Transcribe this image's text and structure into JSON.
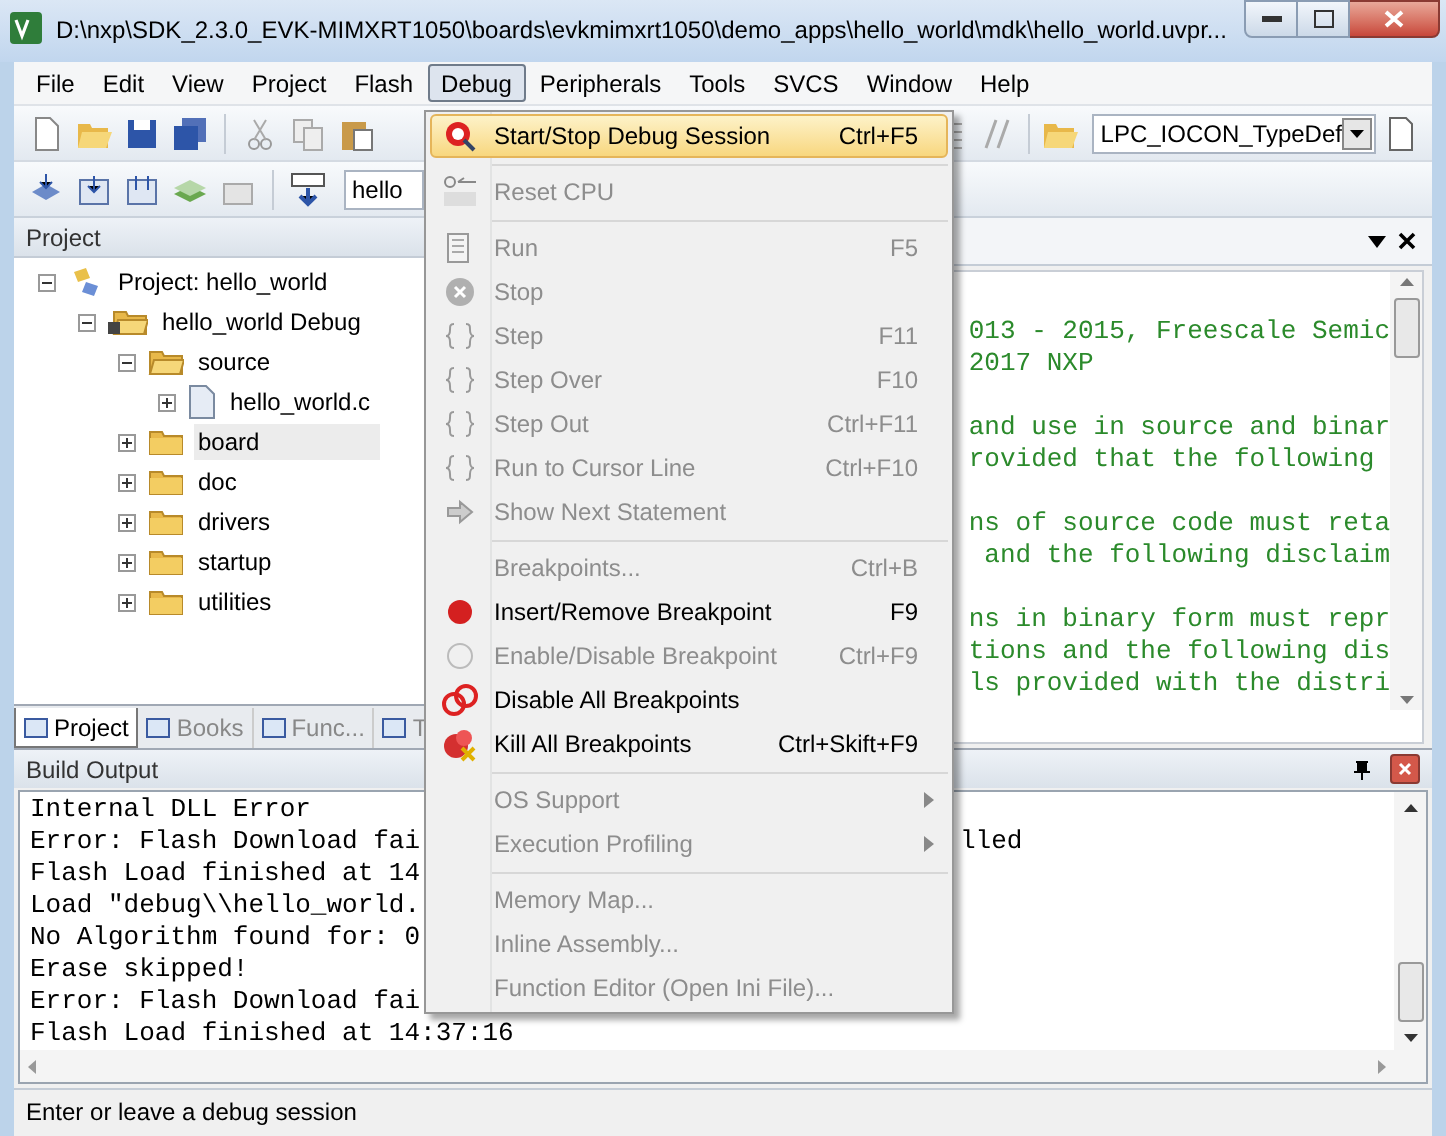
{
  "window": {
    "title": "D:\\nxp\\SDK_2.3.0_EVK-MIMXRT1050\\boards\\evkmimxrt1050\\demo_apps\\hello_world\\mdk\\hello_world.uvpr..."
  },
  "menubar": [
    {
      "label": "File",
      "selected": false
    },
    {
      "label": "Edit",
      "selected": false
    },
    {
      "label": "View",
      "selected": false
    },
    {
      "label": "Project",
      "selected": false
    },
    {
      "label": "Flash",
      "selected": false
    },
    {
      "label": "Debug",
      "selected": true
    },
    {
      "label": "Peripherals",
      "selected": false
    },
    {
      "label": "Tools",
      "selected": false
    },
    {
      "label": "SVCS",
      "selected": false
    },
    {
      "label": "Window",
      "selected": false
    },
    {
      "label": "Help",
      "selected": false
    }
  ],
  "toolbar": {
    "type_combo": "LPC_IOCON_TypeDef",
    "target_combo": "hello"
  },
  "project": {
    "title": "Project",
    "tree": [
      {
        "label": "Project: hello_world",
        "kind": "project",
        "expanded": true,
        "selected": false,
        "children": [
          {
            "label": "hello_world Debug",
            "kind": "target",
            "expanded": true,
            "selected": false,
            "children": [
              {
                "label": "source",
                "kind": "folder",
                "expanded": true,
                "selected": false,
                "children": [
                  {
                    "label": "hello_world.c",
                    "kind": "file",
                    "expanded": false,
                    "selected": false
                  }
                ]
              },
              {
                "label": "board",
                "kind": "folder",
                "expanded": false,
                "selected": true
              },
              {
                "label": "doc",
                "kind": "folder",
                "expanded": false,
                "selected": false
              },
              {
                "label": "drivers",
                "kind": "folder",
                "expanded": false,
                "selected": false
              },
              {
                "label": "startup",
                "kind": "folder",
                "expanded": false,
                "selected": false
              },
              {
                "label": "utilities",
                "kind": "folder",
                "expanded": false,
                "selected": false
              }
            ]
          }
        ]
      }
    ],
    "tabs": [
      {
        "label": "Project",
        "selected": true
      },
      {
        "label": "Books",
        "selected": false
      },
      {
        "label": "Func...",
        "selected": false
      },
      {
        "label": "T",
        "selected": false
      }
    ]
  },
  "editor": {
    "code_paragraphs": [
      [
        "013 - 2015, Freescale Semic",
        "2017 NXP"
      ],
      [
        "and use in source and binar",
        "rovided that the following"
      ],
      [
        "ns of source code must reta",
        " and the following disclaim"
      ],
      [
        "ns in binary form must repr",
        "tions and the following dis",
        "ls provided with the distri"
      ]
    ]
  },
  "build_output": {
    "title": "Build Output",
    "lines": [
      {
        "text": "Internal DLL Error"
      },
      {
        "text": "Error: Flash Download fai",
        "tail": "lled"
      },
      {
        "text": "Flash Load finished at 14"
      },
      {
        "text": "Load \"debug\\\\hello_world."
      },
      {
        "text": "No Algorithm found for: 0"
      },
      {
        "text": "Erase skipped!"
      },
      {
        "text": "Error: Flash Download fai"
      },
      {
        "text": "Flash Load finished at 14:37:16"
      }
    ]
  },
  "debug_menu": [
    {
      "kind": "item",
      "label": "Start/Stop Debug Session",
      "shortcut": "Ctrl+F5",
      "disabled": false,
      "selected": true
    },
    {
      "kind": "separator"
    },
    {
      "kind": "item",
      "label": "Reset CPU",
      "disabled": true,
      "selected": false
    },
    {
      "kind": "separator"
    },
    {
      "kind": "item",
      "label": "Run",
      "shortcut": "F5",
      "disabled": true,
      "selected": false
    },
    {
      "kind": "item",
      "label": "Stop",
      "disabled": true,
      "selected": false
    },
    {
      "kind": "item",
      "label": "Step",
      "shortcut": "F11",
      "disabled": true,
      "selected": false
    },
    {
      "kind": "item",
      "label": "Step Over",
      "shortcut": "F10",
      "disabled": true,
      "selected": false
    },
    {
      "kind": "item",
      "label": "Step Out",
      "shortcut": "Ctrl+F11",
      "disabled": true,
      "selected": false
    },
    {
      "kind": "item",
      "label": "Run to Cursor Line",
      "shortcut": "Ctrl+F10",
      "disabled": true,
      "selected": false
    },
    {
      "kind": "item",
      "label": "Show Next Statement",
      "disabled": true,
      "selected": false
    },
    {
      "kind": "separator"
    },
    {
      "kind": "item",
      "label": "Breakpoints...",
      "shortcut": "Ctrl+B",
      "disabled": true,
      "selected": false
    },
    {
      "kind": "item",
      "label": "Insert/Remove Breakpoint",
      "shortcut": "F9",
      "disabled": false,
      "selected": false
    },
    {
      "kind": "item",
      "label": "Enable/Disable Breakpoint",
      "shortcut": "Ctrl+F9",
      "disabled": true,
      "selected": false
    },
    {
      "kind": "item",
      "label": "Disable All Breakpoints",
      "disabled": false,
      "selected": false
    },
    {
      "kind": "item",
      "label": "Kill All Breakpoints",
      "shortcut": "Ctrl+Skift+F9",
      "disabled": false,
      "selected": false
    },
    {
      "kind": "separator"
    },
    {
      "kind": "submenu",
      "label": "OS Support",
      "disabled": true,
      "selected": false
    },
    {
      "kind": "submenu",
      "label": "Execution Profiling",
      "disabled": true,
      "selected": false
    },
    {
      "kind": "separator"
    },
    {
      "kind": "item",
      "label": "Memory Map...",
      "disabled": true,
      "selected": false
    },
    {
      "kind": "item",
      "label": "Inline Assembly...",
      "disabled": true,
      "selected": false
    },
    {
      "kind": "item",
      "label": "Function Editor (Open Ini File)...",
      "disabled": true,
      "selected": false
    }
  ],
  "status_bar": {
    "text": "Enter or leave a debug session"
  }
}
